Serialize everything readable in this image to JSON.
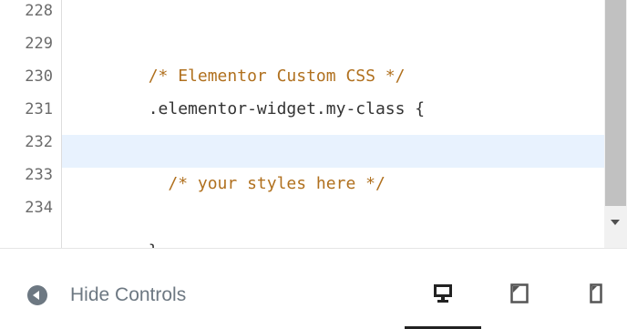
{
  "editor": {
    "lines": [
      {
        "number": "228",
        "text": "",
        "type": "plain",
        "active": false
      },
      {
        "number": "229",
        "text": "/* Elementor Custom CSS */",
        "type": "comment",
        "active": false
      },
      {
        "number": "230",
        "text": ".elementor-widget.my-class {",
        "type": "plain",
        "active": false
      },
      {
        "number": "231",
        "text": "",
        "type": "plain",
        "active": false
      },
      {
        "number": "232",
        "text": "  /* your styles here */",
        "type": "comment",
        "active": true
      },
      {
        "number": "233",
        "text": "",
        "type": "plain",
        "active": false
      },
      {
        "number": "234",
        "text": "}",
        "type": "plain",
        "active": false
      }
    ]
  },
  "footer": {
    "hide_controls_label": "Hide Controls",
    "hide_controls_icon": "chevron-left-circle-icon",
    "devices": [
      {
        "name": "desktop",
        "icon": "desktop-icon",
        "active": true
      },
      {
        "name": "tablet",
        "icon": "tablet-icon",
        "active": false
      },
      {
        "name": "mobile",
        "icon": "mobile-icon",
        "active": false
      }
    ]
  },
  "colors": {
    "comment": "#b0701e",
    "code": "#333333",
    "active_line": "#e8f2fe",
    "line_number": "#6b6b6b",
    "footer_text": "#6d7882"
  }
}
